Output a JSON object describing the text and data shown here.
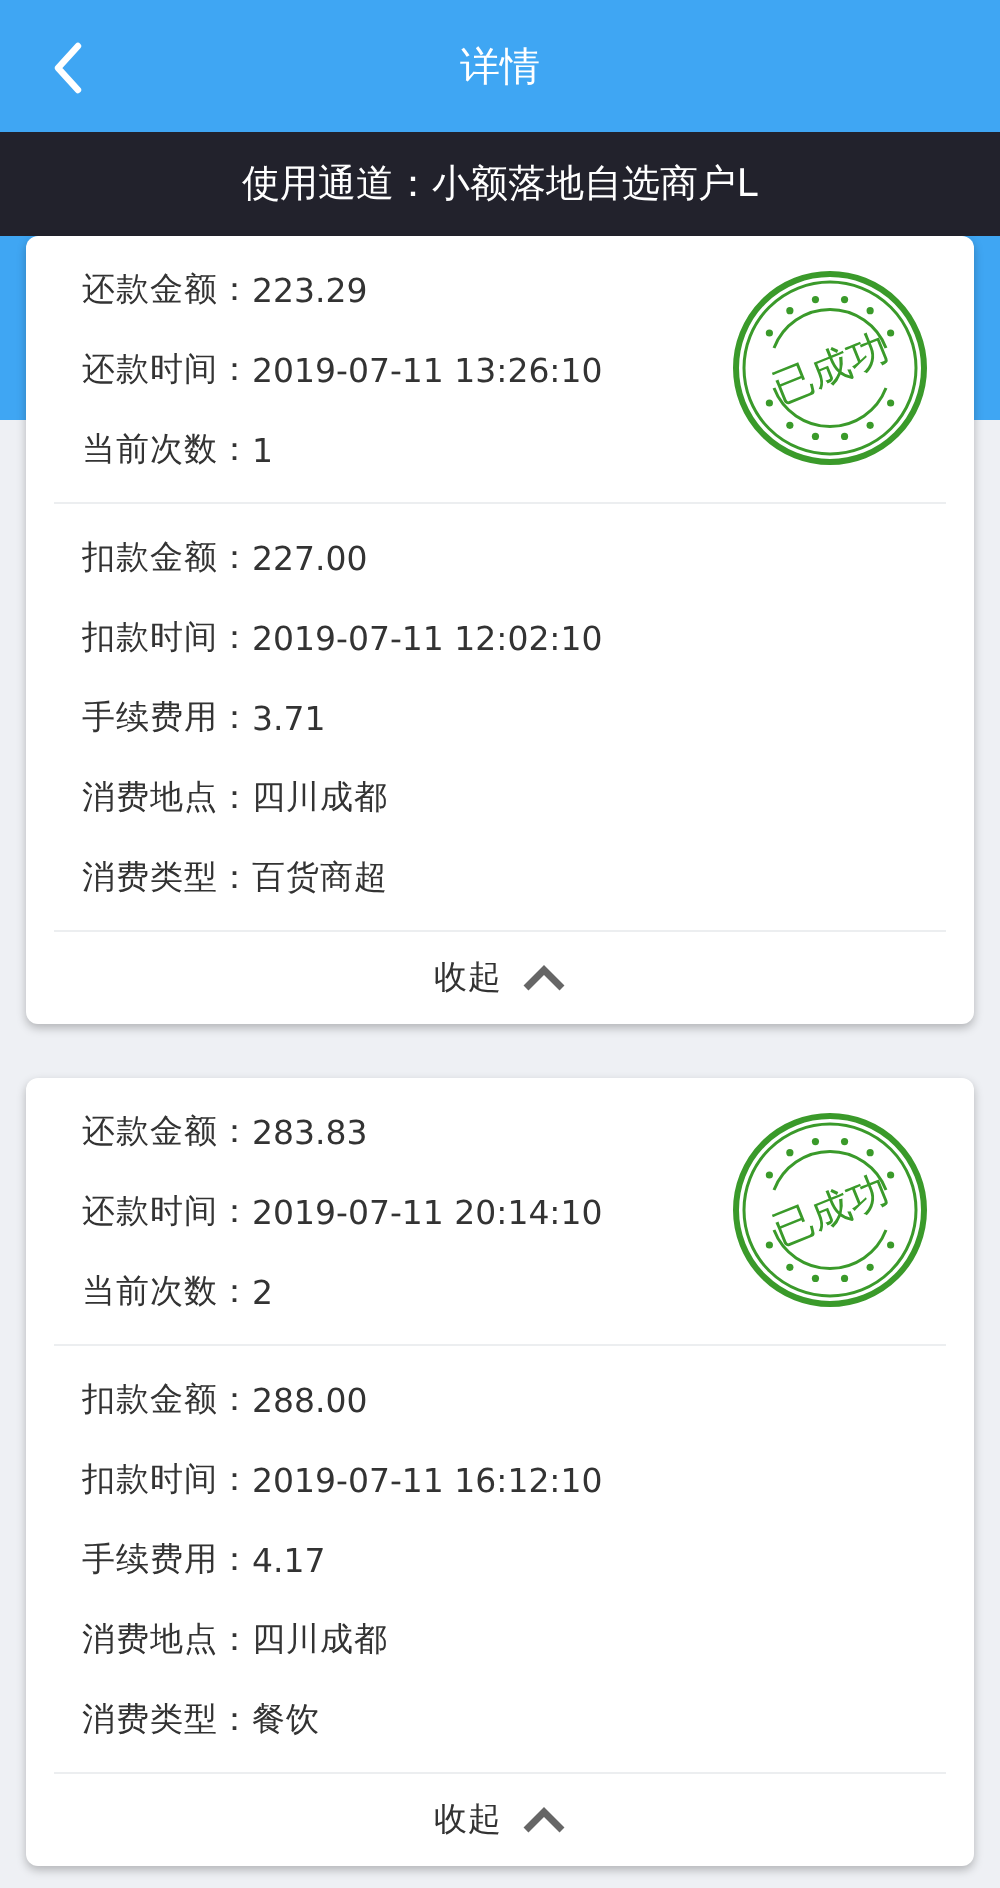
{
  "header": {
    "title": "详情"
  },
  "channel_bar": {
    "text": "使用通道：小额落地自选商户L"
  },
  "records": [
    {
      "stamp": "已成功",
      "expanded": true,
      "collapse_label": "收起",
      "summary": [
        {
          "label": "还款金额：",
          "value": "223.29"
        },
        {
          "label": "还款时间：",
          "value": "2019-07-11 13:26:10"
        },
        {
          "label": "当前次数：",
          "value": "1"
        }
      ],
      "details": [
        {
          "label": "扣款金额：",
          "value": "227.00"
        },
        {
          "label": "扣款时间：",
          "value": "2019-07-11 12:02:10"
        },
        {
          "label": "手续费用：",
          "value": "3.71"
        },
        {
          "label": "消费地点：",
          "value": "四川成都"
        },
        {
          "label": "消费类型：",
          "value": "百货商超"
        }
      ]
    },
    {
      "stamp": "已成功",
      "expanded": true,
      "collapse_label": "收起",
      "summary": [
        {
          "label": "还款金额：",
          "value": "283.83"
        },
        {
          "label": "还款时间：",
          "value": "2019-07-11 20:14:10"
        },
        {
          "label": "当前次数：",
          "value": "2"
        }
      ],
      "details": [
        {
          "label": "扣款金额：",
          "value": "288.00"
        },
        {
          "label": "扣款时间：",
          "value": "2019-07-11 16:12:10"
        },
        {
          "label": "手续费用：",
          "value": "4.17"
        },
        {
          "label": "消费地点：",
          "value": "四川成都"
        },
        {
          "label": "消费类型：",
          "value": "餐饮"
        }
      ]
    }
  ]
}
